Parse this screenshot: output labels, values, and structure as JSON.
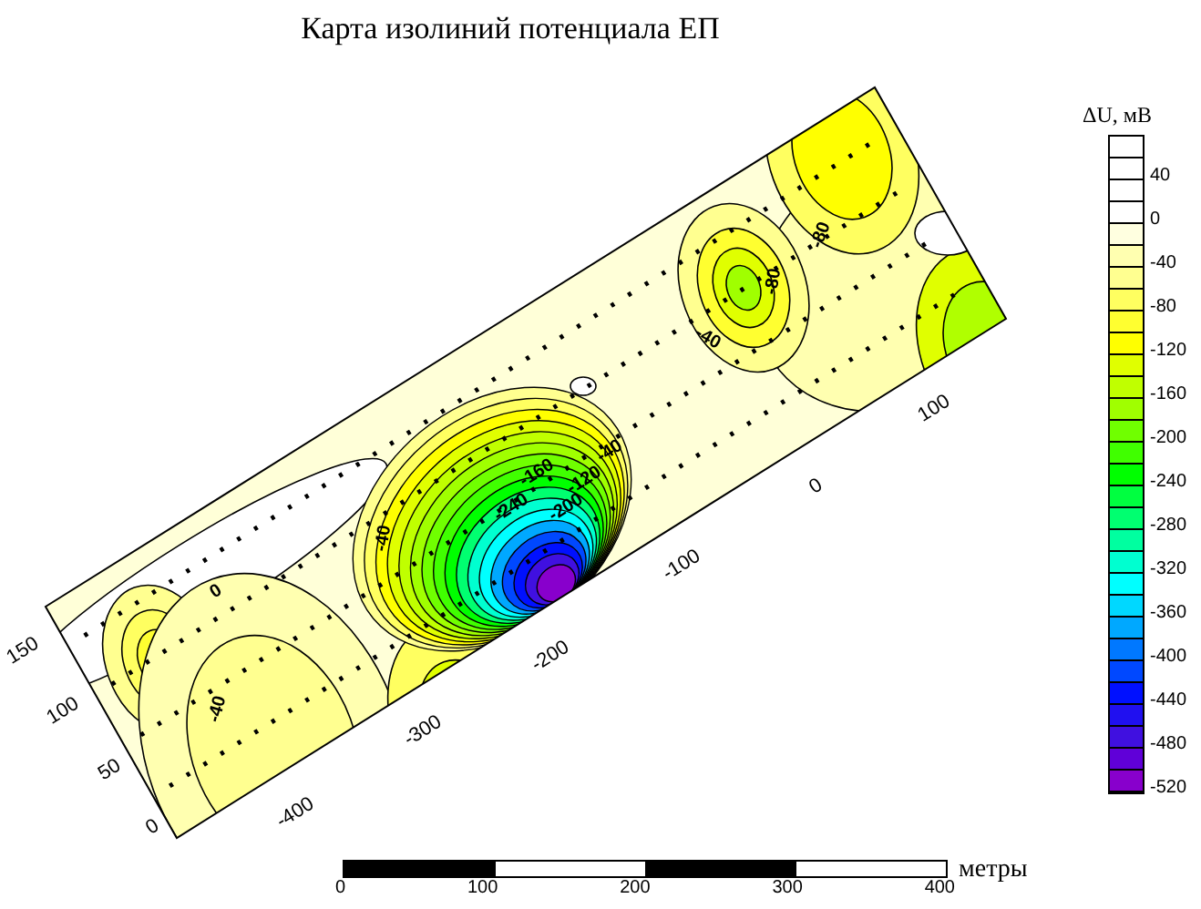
{
  "title": "Карта изолиний потенциала ЕП",
  "map": {
    "y_axis_labels": [
      "150",
      "100",
      "50",
      "0"
    ],
    "x_axis_labels": [
      "-400",
      "-300",
      "-200",
      "-100",
      "0",
      "100"
    ],
    "contour_labels": [
      "0",
      "-40",
      "-40",
      "-40",
      "-120",
      "-160",
      "-200",
      "-240",
      "-40",
      "-80",
      "-80"
    ]
  },
  "legend": {
    "title": "ΔU, мВ",
    "swatches": [
      {
        "color": "#ffffff"
      },
      {
        "color": "#ffffff"
      },
      {
        "color": "#ffffff"
      },
      {
        "color": "#ffffff"
      },
      {
        "color": "#ffffe0"
      },
      {
        "color": "#ffffb0"
      },
      {
        "color": "#ffff90"
      },
      {
        "color": "#ffff60"
      },
      {
        "color": "#ffff30"
      },
      {
        "color": "#ffff00"
      },
      {
        "color": "#e0ff00"
      },
      {
        "color": "#c0ff00"
      },
      {
        "color": "#a0ff00"
      },
      {
        "color": "#70ff00"
      },
      {
        "color": "#40ff00"
      },
      {
        "color": "#00ff00"
      },
      {
        "color": "#00ff40"
      },
      {
        "color": "#00ff70"
      },
      {
        "color": "#00ffa0"
      },
      {
        "color": "#00ffd0"
      },
      {
        "color": "#00ffff"
      },
      {
        "color": "#00d8ff"
      },
      {
        "color": "#00a8ff"
      },
      {
        "color": "#0078ff"
      },
      {
        "color": "#0048ff"
      },
      {
        "color": "#0010ff"
      },
      {
        "color": "#2010f0"
      },
      {
        "color": "#4010e0"
      },
      {
        "color": "#6000d8"
      },
      {
        "color": "#8800cc"
      }
    ],
    "labels": [
      "40",
      "0",
      "-40",
      "-80",
      "-120",
      "-160",
      "-200",
      "-240",
      "-280",
      "-320",
      "-360",
      "-400",
      "-440",
      "-480",
      "-520"
    ]
  },
  "scale_bar": {
    "labels": [
      "0",
      "100",
      "200",
      "300",
      "400"
    ],
    "unit": "метры"
  }
}
